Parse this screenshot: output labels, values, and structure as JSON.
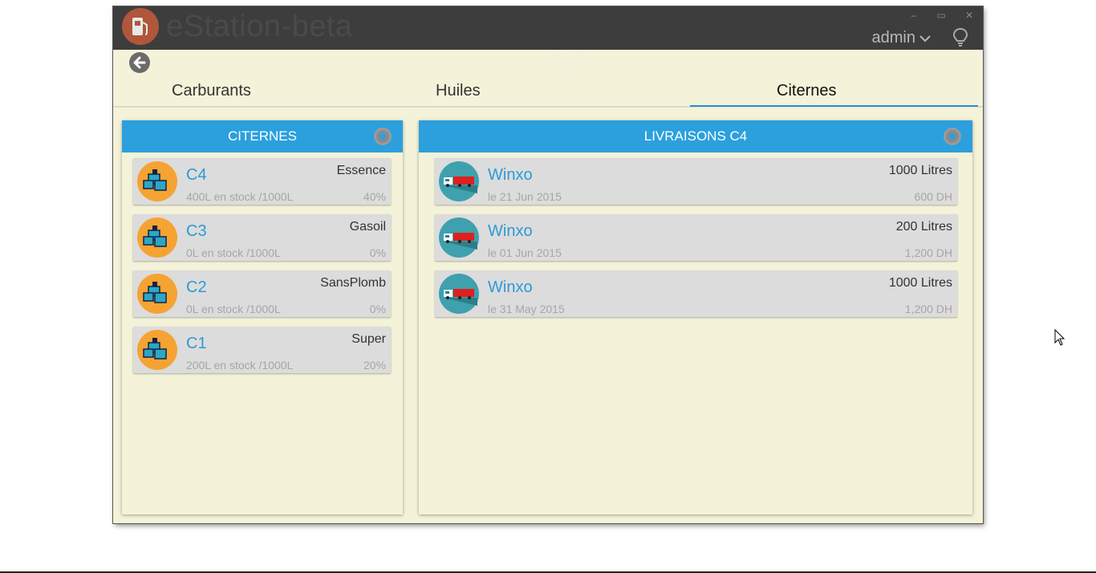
{
  "app": {
    "title": "eStation-beta",
    "user": "admin",
    "page_title": "Stock",
    "window_controls": {
      "minimize": "‒",
      "maximize": "▭",
      "close": "✕"
    }
  },
  "tabs": [
    {
      "label": "Carburants",
      "active": false
    },
    {
      "label": "Huiles",
      "active": false
    },
    {
      "label": "Citernes",
      "active": true
    }
  ],
  "citernes_panel": {
    "title": "CITERNES",
    "items": [
      {
        "name": "C4",
        "fuel": "Essence",
        "stock": "400L en stock /1000L",
        "percent": "40%"
      },
      {
        "name": "C3",
        "fuel": "Gasoil",
        "stock": "0L en stock /1000L",
        "percent": "0%"
      },
      {
        "name": "C2",
        "fuel": "SansPlomb",
        "stock": "0L en stock /1000L",
        "percent": "0%"
      },
      {
        "name": "C1",
        "fuel": "Super",
        "stock": "200L en stock /1000L",
        "percent": "20%"
      }
    ]
  },
  "livraisons_panel": {
    "title": "LIVRAISONS C4",
    "items": [
      {
        "supplier": "Winxo",
        "quantity": "1000 Litres",
        "date": "le 21 Jun 2015",
        "price": "600 DH"
      },
      {
        "supplier": "Winxo",
        "quantity": "200 Litres",
        "date": "le 01 Jun 2015",
        "price": "1,200 DH"
      },
      {
        "supplier": "Winxo",
        "quantity": "1000 Litres",
        "date": "le 31 May 2015",
        "price": "1,200 DH"
      }
    ]
  },
  "colors": {
    "titlebar": "#3d3d3d",
    "window_bg": "#f4f3da",
    "panel_header": "#2ba0dd",
    "tab_underline": "#2a8fd4",
    "tank_avatar": "#f5a333",
    "truck_avatar": "#3ea1ad",
    "logo": "#b0563a"
  },
  "icons": {
    "logo": "fuel-pump-icon",
    "back": "back-arrow-icon",
    "user_menu": "chevron-down-icon",
    "help": "lightbulb-icon",
    "panel_settings": "gear-icon",
    "tank": "tank-icon",
    "truck": "truck-icon"
  }
}
